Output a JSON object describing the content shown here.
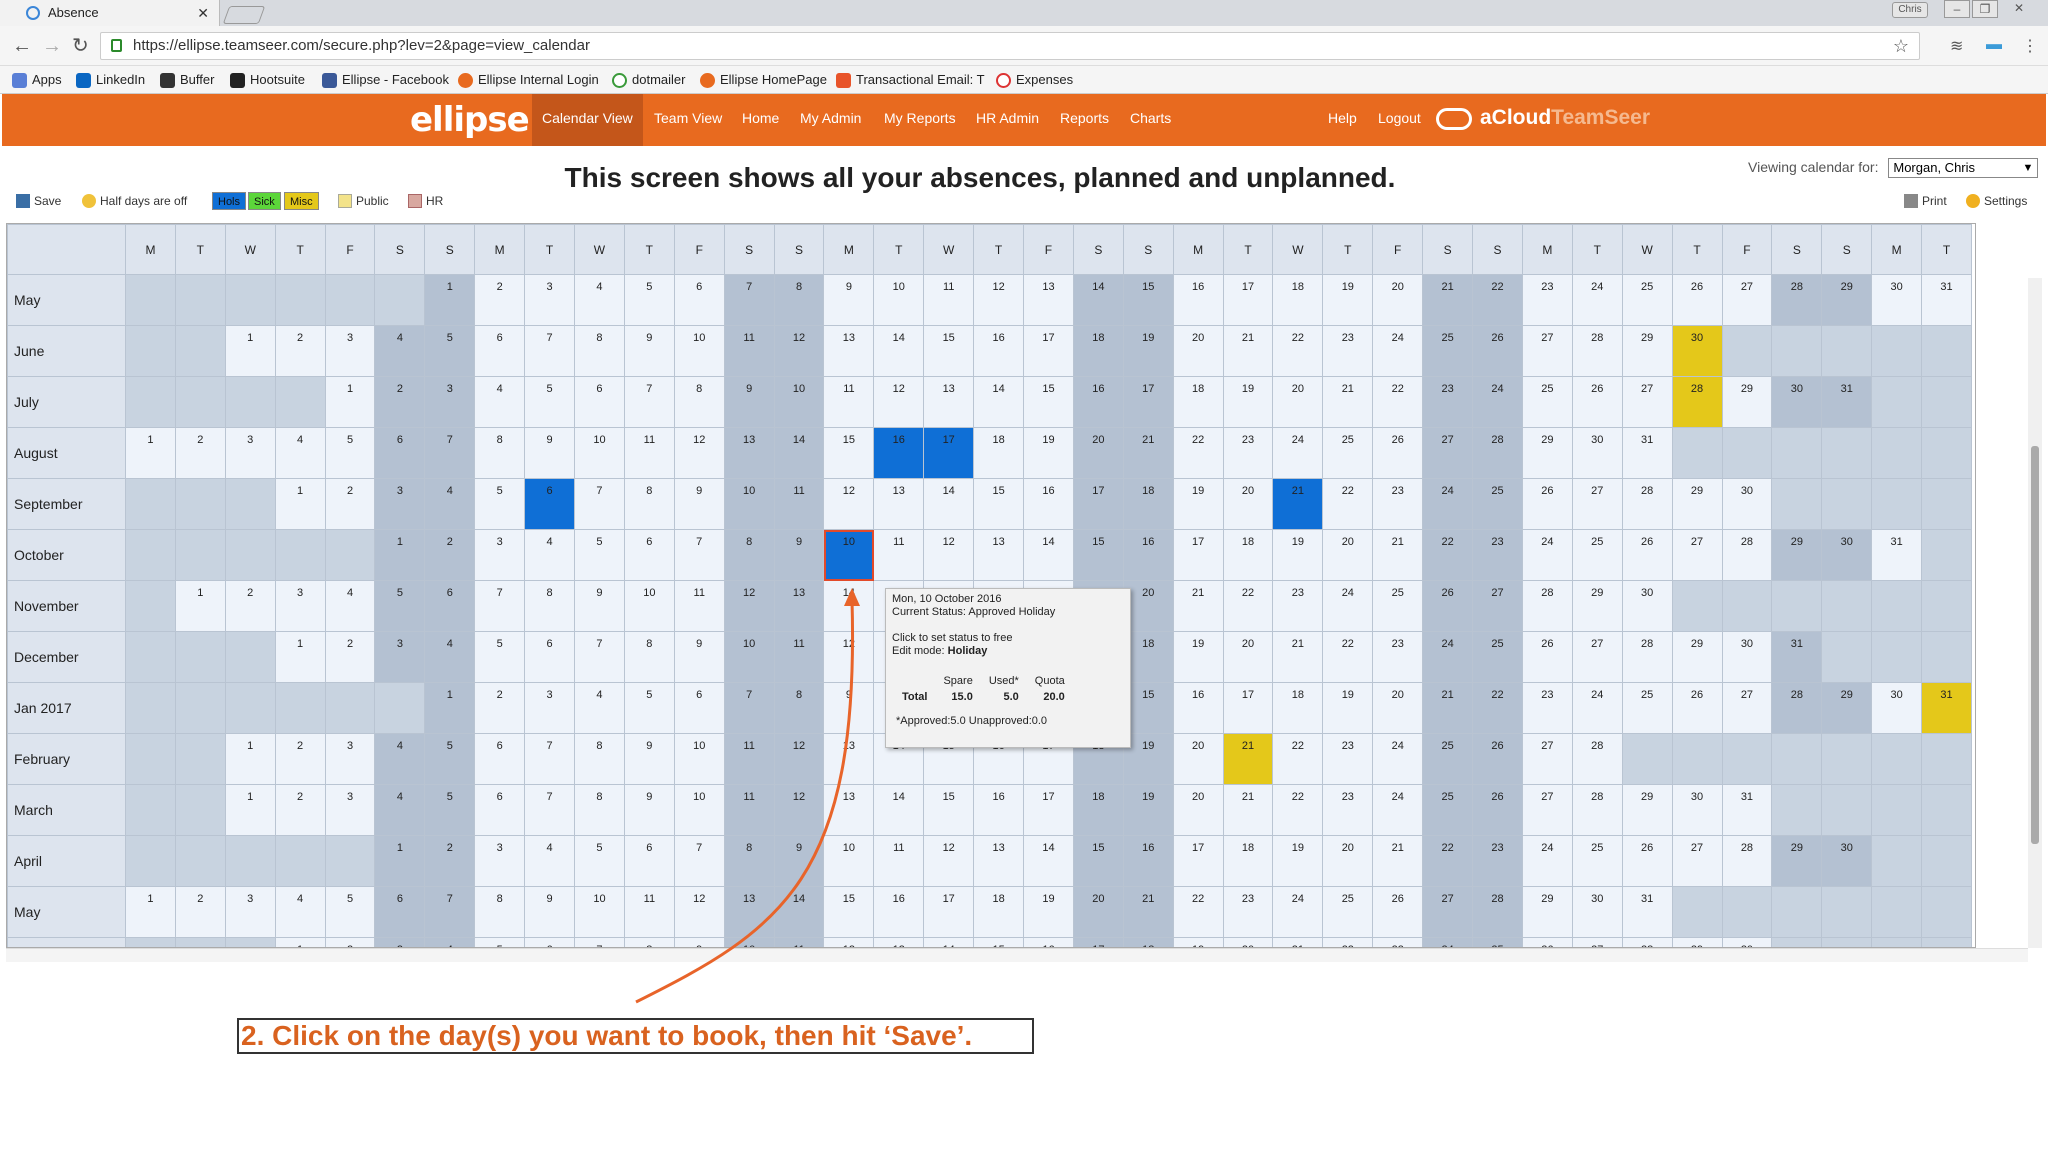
{
  "browser": {
    "tab_title": "Absence",
    "profile": "Chris",
    "url": "https://ellipse.teamseer.com/secure.php?lev=2&page=view_calendar"
  },
  "bookmarks": [
    "Apps",
    "LinkedIn",
    "Buffer",
    "Hootsuite",
    "Ellipse - Facebook",
    "Ellipse Internal Login",
    "dotmailer",
    "Ellipse HomePage",
    "Transactional Email: T",
    "Expenses"
  ],
  "app": {
    "logo": "ellipse",
    "nav": [
      "Calendar View",
      "Team View",
      "Home",
      "My Admin",
      "My Reports",
      "HR Admin",
      "Reports",
      "Charts"
    ],
    "right_nav": [
      "Help",
      "Logout"
    ],
    "brand_bold": "aCloud",
    "brand_light": "TeamSeer"
  },
  "heading": "This screen shows all your absences, planned and unplanned.",
  "viewing": {
    "label": "Viewing calendar for:",
    "value": "Morgan, Chris"
  },
  "toolbar": {
    "save": "Save",
    "half_days": "Half days are off",
    "legend": [
      "Hols",
      "Sick",
      "Misc"
    ],
    "public": "Public",
    "hr": "HR",
    "print": "Print",
    "settings": "Settings"
  },
  "colors": {
    "orange": "#e86a1f",
    "holiday": "#0f6fd6",
    "public": "#e4c81a",
    "weekend": "#b4c1d2",
    "weekday": "#eef3fa"
  },
  "calendar": {
    "day_headers": [
      "M",
      "T",
      "W",
      "T",
      "F",
      "S",
      "S",
      "M",
      "T",
      "W",
      "T",
      "F",
      "S",
      "S",
      "M",
      "T",
      "W",
      "T",
      "F",
      "S",
      "S",
      "M",
      "T",
      "W",
      "T",
      "F",
      "S",
      "S",
      "M",
      "T",
      "W",
      "T",
      "F",
      "S",
      "S",
      "M",
      "T"
    ],
    "months": [
      {
        "name": "May",
        "offset": 6,
        "days": 31
      },
      {
        "name": "June",
        "offset": 2,
        "days": 30
      },
      {
        "name": "July",
        "offset": 4,
        "days": 31
      },
      {
        "name": "August",
        "offset": 0,
        "days": 31
      },
      {
        "name": "September",
        "offset": 3,
        "days": 30
      },
      {
        "name": "October",
        "offset": 5,
        "days": 31
      },
      {
        "name": "November",
        "offset": 1,
        "days": 30
      },
      {
        "name": "December",
        "offset": 3,
        "days": 31
      },
      {
        "name": "Jan 2017",
        "offset": 6,
        "days": 31
      },
      {
        "name": "February",
        "offset": 2,
        "days": 28
      },
      {
        "name": "March",
        "offset": 2,
        "days": 31
      },
      {
        "name": "April",
        "offset": 5,
        "days": 30
      },
      {
        "name": "May",
        "offset": 0,
        "days": 31
      },
      {
        "name": "",
        "offset": 3,
        "days": 30
      }
    ],
    "holidays": [
      [
        3,
        16
      ],
      [
        3,
        17
      ],
      [
        4,
        6
      ],
      [
        4,
        21
      ],
      [
        5,
        10
      ]
    ],
    "public_holidays": [
      [
        1,
        30
      ],
      [
        2,
        28
      ],
      [
        8,
        31
      ],
      [
        9,
        21
      ]
    ],
    "selected": [
      5,
      10
    ]
  },
  "tooltip": {
    "date": "Mon, 10 October 2016",
    "status": "Current Status: Approved Holiday",
    "action": "Click to set status to free",
    "edit_label": "Edit mode:",
    "edit_value": "Holiday",
    "headers": [
      "Spare",
      "Used*",
      "Quota"
    ],
    "total_label": "Total",
    "values": [
      "15.0",
      "5.0",
      "20.0"
    ],
    "note": "*Approved:5.0 Unapproved:0.0"
  },
  "instruction": "2. Click on the day(s) you want to book, then hit ‘Save’."
}
